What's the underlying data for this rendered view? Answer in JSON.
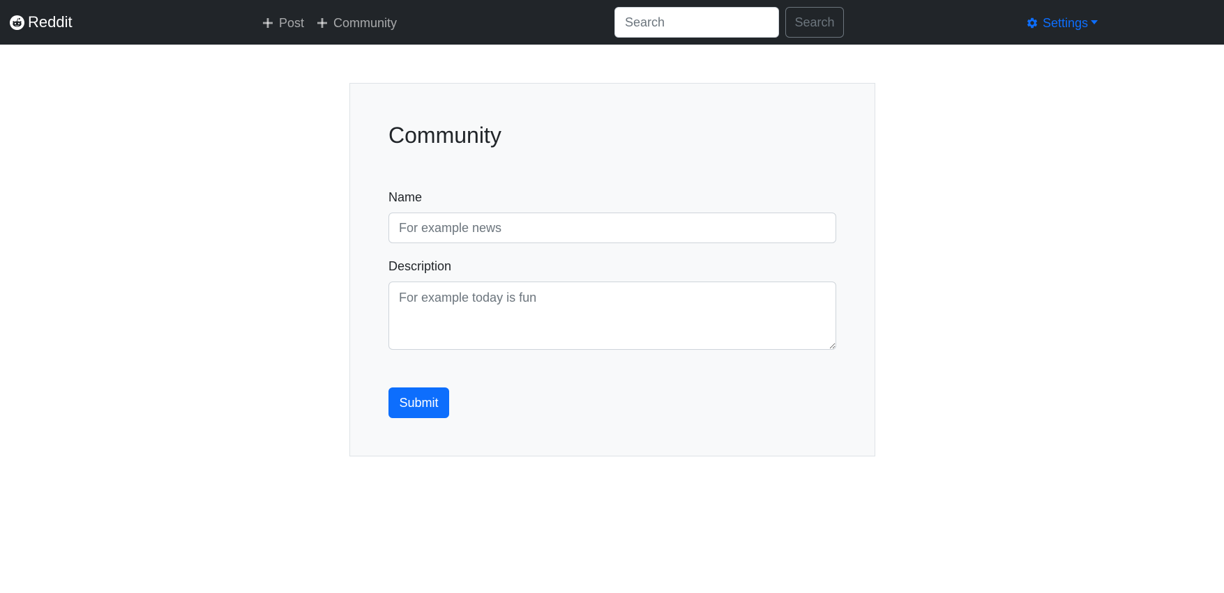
{
  "navbar": {
    "brand": "Reddit",
    "brand_icon": "reddit-logo-icon",
    "links": [
      {
        "label": "Post",
        "icon": "plus-icon"
      },
      {
        "label": "Community",
        "icon": "plus-icon"
      }
    ],
    "search": {
      "placeholder": "Search",
      "value": "",
      "button_label": "Search"
    },
    "settings": {
      "label": "Settings",
      "icon": "gear-icon"
    }
  },
  "form": {
    "title": "Community",
    "name_label": "Name",
    "name_placeholder": "For example news",
    "description_label": "Description",
    "description_placeholder": "For example today is fun",
    "submit_label": "Submit"
  },
  "colors": {
    "navbar_bg": "#212529",
    "accent": "#0d6efd",
    "card_bg": "#f8f9fa"
  }
}
